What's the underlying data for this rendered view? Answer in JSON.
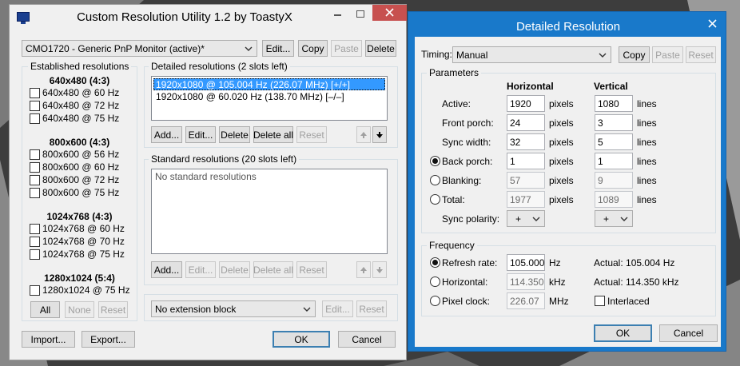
{
  "main_window": {
    "title": "Custom Resolution Utility 1.2 by ToastyX",
    "monitor_value": "CMO1720 - Generic PnP Monitor (active)*",
    "buttons": {
      "edit": "Edit...",
      "copy": "Copy",
      "paste": "Paste",
      "delete": "Delete"
    },
    "established": {
      "group_title": "Established resolutions",
      "sections": [
        {
          "header": "640x480 (4:3)",
          "items": [
            "640x480 @ 60 Hz",
            "640x480 @ 72 Hz",
            "640x480 @ 75 Hz"
          ]
        },
        {
          "header": "800x600 (4:3)",
          "items": [
            "800x600 @ 56 Hz",
            "800x600 @ 60 Hz",
            "800x600 @ 72 Hz",
            "800x600 @ 75 Hz"
          ]
        },
        {
          "header": "1024x768 (4:3)",
          "items": [
            "1024x768 @ 60 Hz",
            "1024x768 @ 70 Hz",
            "1024x768 @ 75 Hz"
          ]
        },
        {
          "header": "1280x1024 (5:4)",
          "items": [
            "1280x1024 @ 75 Hz"
          ]
        }
      ],
      "buttons": {
        "all": "All",
        "none": "None",
        "reset": "Reset"
      }
    },
    "detailed": {
      "group_title": "Detailed resolutions (2 slots left)",
      "rows": [
        "1920x1080 @ 105.004 Hz (226.07 MHz) [+/+]",
        "1920x1080 @ 60.020 Hz (138.70 MHz) [–/–]"
      ],
      "buttons": {
        "add": "Add...",
        "edit": "Edit...",
        "delete": "Delete",
        "delete_all": "Delete all",
        "reset": "Reset"
      }
    },
    "standard": {
      "group_title": "Standard resolutions (20 slots left)",
      "empty_text": "No standard resolutions",
      "buttons": {
        "add": "Add...",
        "edit": "Edit...",
        "delete": "Delete",
        "delete_all": "Delete all",
        "reset": "Reset"
      }
    },
    "extension": {
      "value": "No extension block",
      "edit": "Edit...",
      "reset": "Reset"
    },
    "footer": {
      "import": "Import...",
      "export": "Export...",
      "ok": "OK",
      "cancel": "Cancel"
    }
  },
  "detail_window": {
    "title": "Detailed Resolution",
    "timing_label": "Timing:",
    "timing_value": "Manual",
    "buttons": {
      "copy": "Copy",
      "paste": "Paste",
      "reset": "Reset"
    },
    "parameters": {
      "group_title": "Parameters",
      "col_horizontal": "Horizontal",
      "col_vertical": "Vertical",
      "rows": [
        {
          "label": "Active:",
          "h": "1920",
          "v": "1080"
        },
        {
          "label": "Front porch:",
          "h": "24",
          "v": "3"
        },
        {
          "label": "Sync width:",
          "h": "32",
          "v": "5"
        },
        {
          "label": "Back porch:",
          "h": "1",
          "v": "1"
        },
        {
          "label": "Blanking:",
          "h": "57",
          "v": "9"
        },
        {
          "label": "Total:",
          "h": "1977",
          "v": "1089"
        }
      ],
      "unit_h": "pixels",
      "unit_v": "lines",
      "sync_polarity_label": "Sync polarity:",
      "sync_h": "+",
      "sync_v": "+"
    },
    "frequency": {
      "group_title": "Frequency",
      "refresh_label": "Refresh rate:",
      "refresh_value": "105.000",
      "refresh_unit": "Hz",
      "refresh_actual": "Actual: 105.004 Hz",
      "horizontal_label": "Horizontal:",
      "horizontal_value": "114.350",
      "horizontal_unit": "kHz",
      "horizontal_actual": "Actual: 114.350 kHz",
      "pixel_label": "Pixel clock:",
      "pixel_value": "226.07",
      "pixel_unit": "MHz",
      "interlaced": "Interlaced"
    },
    "footer": {
      "ok": "OK",
      "cancel": "Cancel"
    }
  },
  "colors": {
    "accent": "#1979ca",
    "selection": "#3399ff",
    "close": "#c7504f"
  }
}
